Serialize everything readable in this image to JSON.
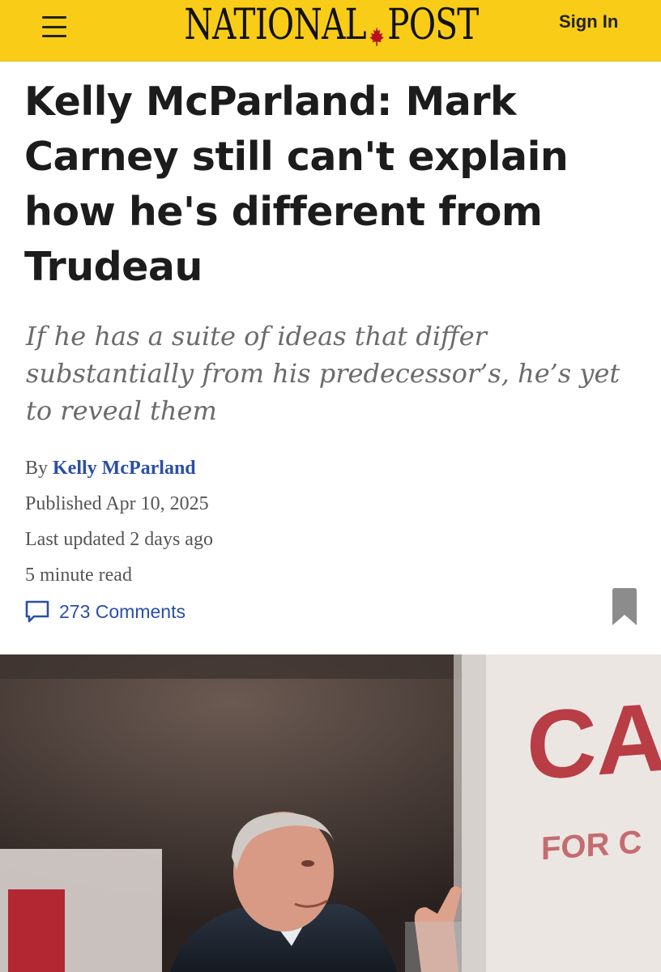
{
  "header": {
    "logo_text_left": "NATIONAL",
    "logo_text_right": "POST",
    "sign_in_label": "Sign In",
    "background_color": "#f9cd17"
  },
  "article": {
    "headline": "Kelly McParland: Mark Carney still can't explain how he's different from Trudeau",
    "subhead": "If he has a suite of ideas that differ substantially from his predecessor’s, he’s yet to reveal them",
    "byline_prefix": "By",
    "author": "Kelly McParland",
    "published": "Published Apr 10, 2025",
    "last_updated": "Last updated 2 days ago",
    "read_time": "5 minute read",
    "comments_label": "273 Comments",
    "link_color": "#2a4fa6"
  },
  "photo": {
    "sign_text_top": "CAR",
    "sign_text_bottom": "FOR C"
  },
  "icons": {
    "menu": "hamburger-menu-icon",
    "logo_leaf": "maple-leaf-icon",
    "comments": "comment-bubble-icon",
    "bookmark": "bookmark-icon"
  }
}
